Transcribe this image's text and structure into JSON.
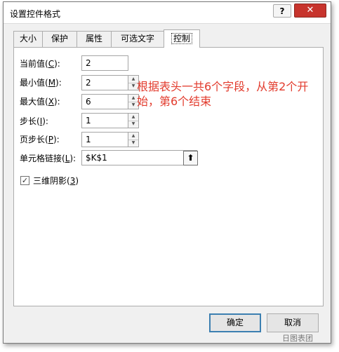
{
  "window": {
    "title": "设置控件格式",
    "help_label": "?",
    "close_label": "✕"
  },
  "tabs": [
    {
      "label": "大小",
      "active": false
    },
    {
      "label": "保护",
      "active": false
    },
    {
      "label": "属性",
      "active": false
    },
    {
      "label": "可选文字",
      "active": false
    },
    {
      "label": "控制",
      "active": true
    }
  ],
  "form": {
    "current_value": {
      "label": "当前值(",
      "hotkey": "C",
      "suffix": "):",
      "value": "2"
    },
    "min_value": {
      "label": "最小值(",
      "hotkey": "M",
      "suffix": "):",
      "value": "2"
    },
    "max_value": {
      "label": "最大值(",
      "hotkey": "X",
      "suffix": "):",
      "value": "6"
    },
    "step": {
      "label": "步长(",
      "hotkey": "I",
      "suffix": "):",
      "value": "1"
    },
    "page_step": {
      "label": "页步长(",
      "hotkey": "P",
      "suffix": "):",
      "value": "1"
    },
    "cell_link": {
      "label": "单元格链接(",
      "hotkey": "L",
      "suffix": "):",
      "value": "$K$1"
    },
    "shading": {
      "label": "三维阴影(",
      "hotkey": "3",
      "suffix": ")",
      "checked": true,
      "check_glyph": "✓"
    }
  },
  "annotation": "根据表头一共6个字段，从第2个开始，第6个结束",
  "buttons": {
    "ok": "确定",
    "cancel": "取消"
  },
  "watermark": "日图表团",
  "icons": {
    "spin_up": "▲",
    "spin_down": "▼",
    "range_picker": "⬆"
  }
}
